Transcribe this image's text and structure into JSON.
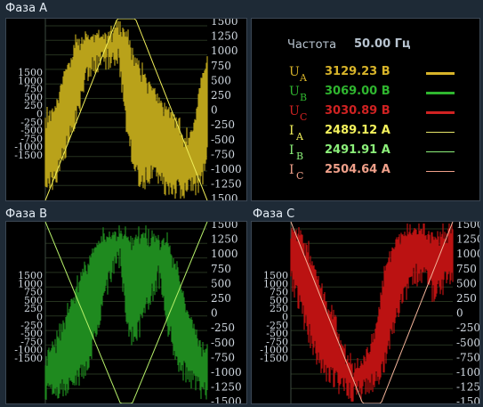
{
  "panels": [
    {
      "id": "a",
      "title": "Фаза A",
      "voltage_color": "#b9a21a",
      "current_color": "#f1ef5a",
      "left_ticks": [
        "1500",
        "1000",
        "750",
        "500",
        "250",
        "0",
        "-250",
        "-500",
        "-750",
        "-1000",
        "-1500"
      ],
      "right_ticks": [
        "1500",
        "1250",
        "1000",
        "750",
        "500",
        "250",
        "0",
        "-250",
        "-500",
        "-750",
        "-1000",
        "-1250",
        "1500"
      ]
    },
    {
      "id": "b",
      "title": "Фаза B",
      "voltage_color": "#1f8a1f",
      "current_color": "#b6f06a",
      "left_ticks": [
        "1500",
        "1000",
        "750",
        "500",
        "250",
        "0",
        "-250",
        "-500",
        "-750",
        "-1000",
        "-1500"
      ],
      "right_ticks": [
        "1500",
        "1250",
        "1000",
        "750",
        "500",
        "250",
        "0",
        "-250",
        "-500",
        "-750",
        "-1000",
        "-1250",
        "-1500"
      ]
    },
    {
      "id": "c",
      "title": "Фаза C",
      "voltage_color": "#bb1212",
      "current_color": "#f3b49a",
      "left_ticks": [
        "1500",
        "1000",
        "750",
        "500",
        "250",
        "0",
        "-250",
        "-500",
        "-750",
        "-1000",
        "-1500"
      ],
      "right_ticks": [
        "1500",
        "1250",
        "1000",
        "750",
        "500",
        "250",
        "0",
        "-250",
        "-500",
        "-750",
        "-1000",
        "-1250",
        "-1500"
      ]
    }
  ],
  "info": {
    "frequency_label": "Частота",
    "frequency_value": "50.00 Гц",
    "rows": [
      {
        "symbol": "U",
        "subscript": "A",
        "value": "3129.23 В",
        "symbol_color": "#d8b42a",
        "value_color": "#d8b42a",
        "line_color": "#d8b42a",
        "line_thick": true
      },
      {
        "symbol": "U",
        "subscript": "B",
        "value": "3069.00 В",
        "symbol_color": "#2fb62f",
        "value_color": "#2fb62f",
        "line_color": "#2fb62f",
        "line_thick": true
      },
      {
        "symbol": "U",
        "subscript": "C",
        "value": "3030.89 В",
        "symbol_color": "#d02222",
        "value_color": "#d02222",
        "line_color": "#d02222",
        "line_thick": true
      },
      {
        "symbol": "I",
        "subscript": "A",
        "value": "2489.12 А",
        "symbol_color": "#f4f25c",
        "value_color": "#f4f25c",
        "line_color": "#e8e66a",
        "line_thick": false
      },
      {
        "symbol": "I",
        "subscript": "B",
        "value": "2491.91 А",
        "symbol_color": "#8cf07a",
        "value_color": "#8cf07a",
        "line_color": "#8cf07a",
        "line_thick": false
      },
      {
        "symbol": "I",
        "subscript": "C",
        "value": "2504.64 А",
        "symbol_color": "#f0a08a",
        "value_color": "#f0a08a",
        "line_color": "#f0a08a",
        "line_thick": false
      }
    ]
  }
}
